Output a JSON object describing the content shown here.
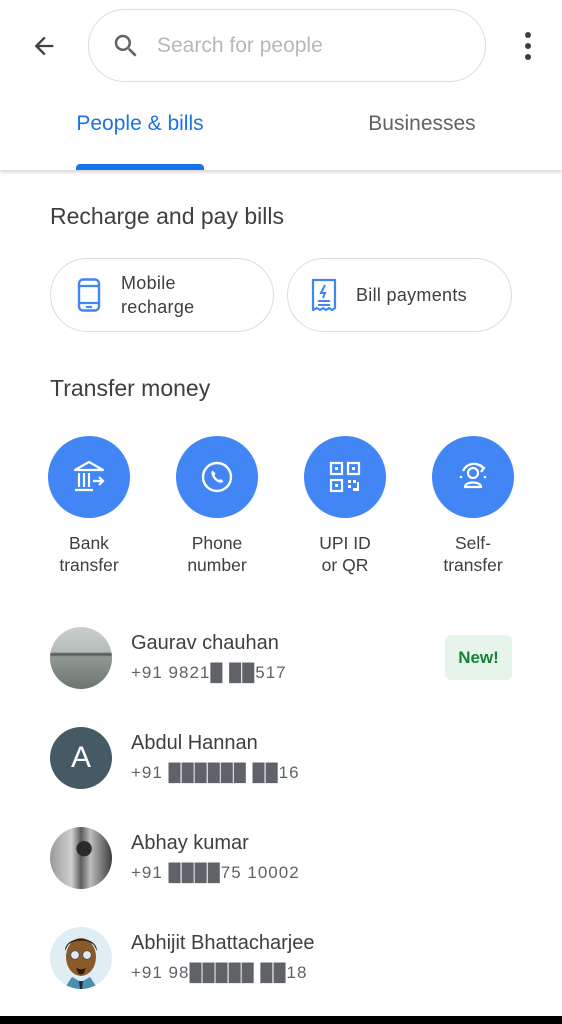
{
  "header": {
    "back_icon": "arrow-back-icon",
    "search": {
      "placeholder": "Search for people",
      "value": "",
      "icon": "search-icon"
    },
    "more_icon": "more-vert-icon"
  },
  "tabs": [
    {
      "label": "People & bills",
      "active": true
    },
    {
      "label": "Businesses",
      "active": false
    }
  ],
  "recharge": {
    "title": "Recharge and pay bills",
    "items": [
      {
        "label": "Mobile\nrecharge",
        "icon": "smartphone-icon"
      },
      {
        "label": "Bill payments",
        "icon": "receipt-icon"
      }
    ]
  },
  "transfer": {
    "title": "Transfer money",
    "items": [
      {
        "label": "Bank\ntransfer",
        "icon": "bank-icon"
      },
      {
        "label": "Phone\nnumber",
        "icon": "phone-icon"
      },
      {
        "label": "UPI ID\nor QR",
        "icon": "qr-code-icon"
      },
      {
        "label": "Self-\ntransfer",
        "icon": "self-transfer-icon"
      }
    ]
  },
  "contacts": [
    {
      "name": "Gaurav chauhan",
      "phone": "+91 9821█ ██517",
      "badge": "New!",
      "avatar": "photo"
    },
    {
      "name": "Abdul Hannan",
      "phone": "+91 ██████ ██16",
      "initial": "A",
      "avatar": "initial"
    },
    {
      "name": "Abhay kumar",
      "phone": "+91 ████75 10002",
      "avatar": "photo"
    },
    {
      "name": "Abhijit Bhattacharjee",
      "phone": "+91 98█████ ██18",
      "avatar": "cartoon"
    }
  ],
  "colors": {
    "accent": "#1a73e8",
    "action_circle": "#4285f4",
    "badge_bg": "#e6f4ea",
    "badge_text": "#188038",
    "initial_avatar": "#455a64"
  }
}
